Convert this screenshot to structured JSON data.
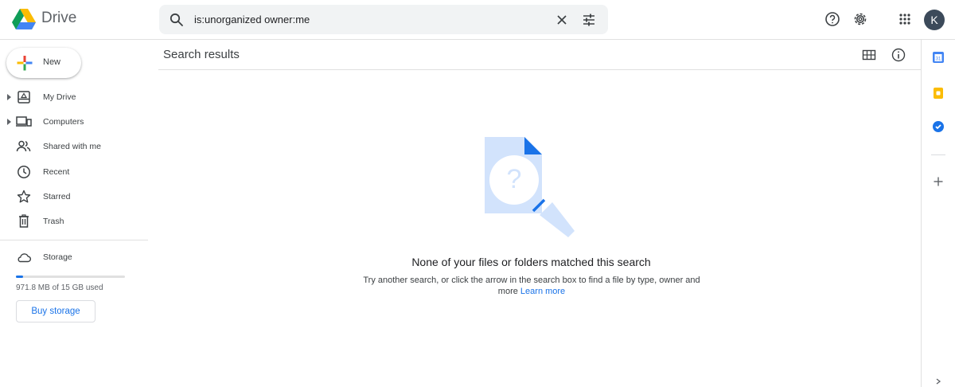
{
  "header": {
    "brand": "Drive",
    "search_query": "is:unorganized owner:me",
    "avatar_initial": "K",
    "logo_icon": "google-drive-logo",
    "buttons": [
      "search-icon",
      "close-icon",
      "tune-icon",
      "help-icon",
      "settings-icon",
      "apps-icon"
    ]
  },
  "sidebar": {
    "new_label": "New",
    "items": [
      {
        "label": "My Drive",
        "icon": "my-drive-icon",
        "expandable": true
      },
      {
        "label": "Computers",
        "icon": "computers-icon",
        "expandable": true
      },
      {
        "label": "Shared with me",
        "icon": "people-icon",
        "expandable": false
      },
      {
        "label": "Recent",
        "icon": "clock-icon",
        "expandable": false
      },
      {
        "label": "Starred",
        "icon": "star-icon",
        "expandable": false
      },
      {
        "label": "Trash",
        "icon": "trash-icon",
        "expandable": false
      }
    ],
    "storage": {
      "label": "Storage",
      "icon": "cloud-icon",
      "used_text": "971.8 MB of 15 GB used",
      "used_fraction": 0.065,
      "buy_label": "Buy storage"
    }
  },
  "main": {
    "title": "Search results",
    "empty_title": "None of your files or folders matched this search",
    "empty_desc": "Try another search, or click the arrow in the search box to find a file by type, owner and more",
    "learn_more": "Learn more",
    "illustration": "search-not-found-illustration"
  },
  "right_rail": {
    "items": [
      "calendar-icon",
      "keep-icon",
      "tasks-icon",
      "add-icon"
    ]
  },
  "colors": {
    "accent": "#1a73e8",
    "avatar_bg": "#3c4a5a",
    "search_bg": "#f1f3f4",
    "illustration_light": "#d2e3fc"
  }
}
